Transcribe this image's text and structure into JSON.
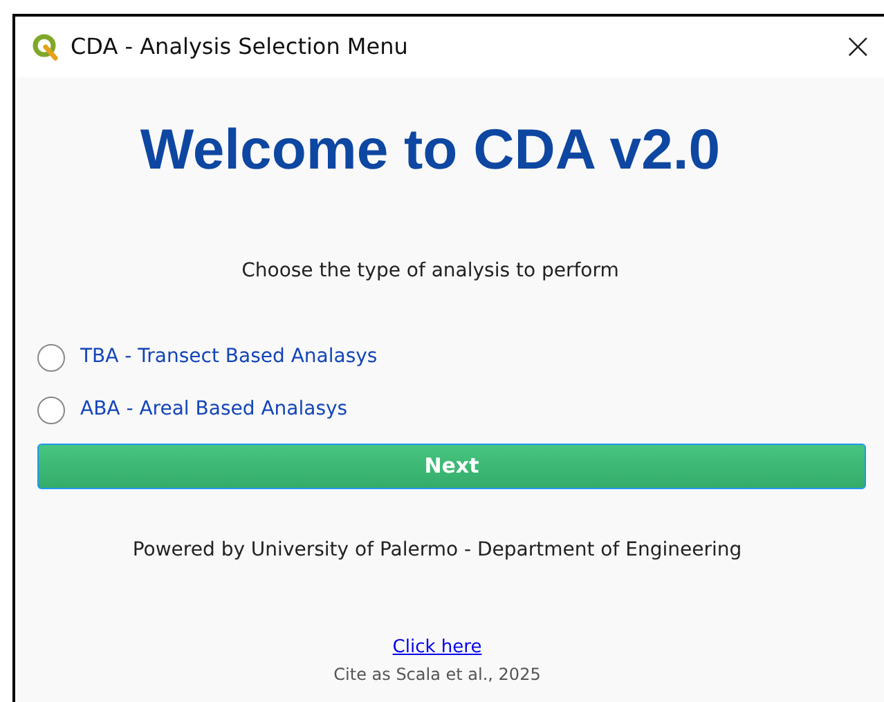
{
  "window": {
    "title": "CDA - Analysis Selection Menu",
    "close": "×"
  },
  "heading": "Welcome to CDA v2.0",
  "prompt": "Choose the type of analysis to perform",
  "options": [
    {
      "label": "TBA - Transect Based Analasys",
      "selected": false
    },
    {
      "label": "ABA - Areal Based Analasys",
      "selected": false
    }
  ],
  "next_button": "Next",
  "credit": "Powered by University of Palermo - Department of Engineering",
  "link": "Click here",
  "citation": "Cite as Scala et al., 2025"
}
